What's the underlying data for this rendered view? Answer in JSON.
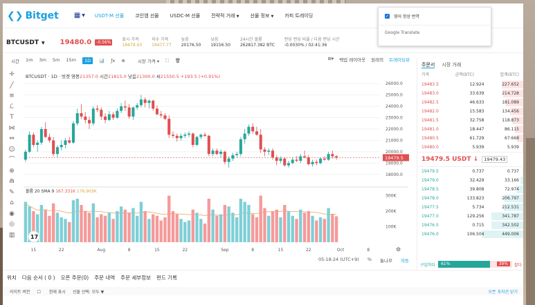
{
  "nav": {
    "logo": "Bitget",
    "items": [
      {
        "label": "USDT-M 선물",
        "active": true,
        "chevron": false
      },
      {
        "label": "코인엠 선물",
        "active": false,
        "chevron": false
      },
      {
        "label": "USDC-M 선물",
        "active": false,
        "chevron": false
      },
      {
        "label": "전략적 거래",
        "active": false,
        "chevron": true
      },
      {
        "label": "선물 정보",
        "active": false,
        "chevron": true
      },
      {
        "label": "카피 트레이딩",
        "active": false,
        "chevron": false
      }
    ]
  },
  "translate_popup": {
    "always_translate": "영어 항상 번역",
    "brand": "Google Translate"
  },
  "ticker": {
    "symbol": "BTCUSDT",
    "price": "19480.0",
    "change": "-0.56%",
    "stats": [
      {
        "k": "표시 가격",
        "v": "19479.43",
        "orange": true
      },
      {
        "k": "지수 가격",
        "v": "19477.77",
        "orange": true
      },
      {
        "k": "높음",
        "v": "20176.50",
        "orange": false
      },
      {
        "k": "낮음",
        "v": "19156.50",
        "orange": false
      },
      {
        "k": "24시간 볼륨",
        "v": "262817.382 BTC",
        "orange": false
      },
      {
        "k": "펀딩 펀딩 비율 / 다음 펀딩 시간",
        "v": "-0.0030% / 02:41:36",
        "orange": false
      }
    ]
  },
  "toolbar": {
    "timeframes": [
      "시간",
      "1m",
      "3m",
      "5m",
      "15m",
      "1D"
    ],
    "active_timeframe": "1D",
    "market_price": "시장 가격",
    "right": [
      "백업 레이아웃",
      "원래의",
      "트레이딩뷰"
    ]
  },
  "chart_info": {
    "title": "BTCUSDT · 1D · 빗겟",
    "open_label": "영봉",
    "open": "21357.0",
    "high_label": "시간",
    "high": "21815.0",
    "low_label": "낮음",
    "low": "21300.0",
    "close_label": "씨",
    "close": "21550.5",
    "change": "+193.5 (+0.91%)"
  },
  "vol_info": {
    "label": "볼륨 20 SMA 9",
    "v1": "167.331K",
    "v2": "176.903K"
  },
  "chart_data": {
    "type": "candlestick",
    "title": "BTCUSDT · 1D · 빗겟",
    "yticks": [
      "26000.0",
      "25000.0",
      "24000.0",
      "23000.0",
      "22000.0",
      "21000.0",
      "20000.0",
      "19000.0",
      "18000.0"
    ],
    "ylim": [
      17500,
      26500
    ],
    "vol_ticks": [
      "300K",
      "200K",
      "100K"
    ],
    "xticks": [
      {
        "label": "15",
        "i": 2
      },
      {
        "label": "22",
        "i": 9
      },
      {
        "label": "Aug",
        "i": 19
      },
      {
        "label": "8",
        "i": 26
      },
      {
        "label": "15",
        "i": 33
      },
      {
        "label": "22",
        "i": 40
      },
      {
        "label": "Sep",
        "i": 50
      },
      {
        "label": "8",
        "i": 57
      },
      {
        "label": "15",
        "i": 64
      },
      {
        "label": "22",
        "i": 71
      },
      {
        "label": "Oct",
        "i": 79
      },
      {
        "label": "8",
        "i": 86
      }
    ],
    "last_price": "19479.5",
    "candles": [
      {
        "o": 19300,
        "h": 20200,
        "l": 19100,
        "c": 20000,
        "v": 260
      },
      {
        "o": 20000,
        "h": 21800,
        "l": 19900,
        "c": 21500,
        "v": 230
      },
      {
        "o": 21500,
        "h": 21700,
        "l": 20400,
        "c": 20600,
        "v": 200
      },
      {
        "o": 20600,
        "h": 21000,
        "l": 20000,
        "c": 20800,
        "v": 180
      },
      {
        "o": 20800,
        "h": 22200,
        "l": 20600,
        "c": 22000,
        "v": 240
      },
      {
        "o": 22000,
        "h": 22600,
        "l": 21200,
        "c": 21300,
        "v": 210
      },
      {
        "o": 21300,
        "h": 21600,
        "l": 20800,
        "c": 21000,
        "v": 170
      },
      {
        "o": 21000,
        "h": 21300,
        "l": 19600,
        "c": 19800,
        "v": 250
      },
      {
        "o": 19800,
        "h": 20600,
        "l": 19500,
        "c": 20400,
        "v": 190
      },
      {
        "o": 20400,
        "h": 21000,
        "l": 20100,
        "c": 20600,
        "v": 160
      },
      {
        "o": 20600,
        "h": 21200,
        "l": 20300,
        "c": 21000,
        "v": 150
      },
      {
        "o": 21000,
        "h": 21300,
        "l": 20700,
        "c": 20800,
        "v": 130
      },
      {
        "o": 20800,
        "h": 22700,
        "l": 20700,
        "c": 22500,
        "v": 270
      },
      {
        "o": 22500,
        "h": 23800,
        "l": 22300,
        "c": 23400,
        "v": 280
      },
      {
        "o": 23400,
        "h": 24200,
        "l": 22900,
        "c": 23100,
        "v": 240
      },
      {
        "o": 23100,
        "h": 23500,
        "l": 22500,
        "c": 22800,
        "v": 200
      },
      {
        "o": 22800,
        "h": 23100,
        "l": 22000,
        "c": 22500,
        "v": 190
      },
      {
        "o": 22500,
        "h": 24000,
        "l": 22300,
        "c": 23800,
        "v": 250
      },
      {
        "o": 23800,
        "h": 24100,
        "l": 23500,
        "c": 23700,
        "v": 160
      },
      {
        "o": 23700,
        "h": 23900,
        "l": 22800,
        "c": 23100,
        "v": 180
      },
      {
        "o": 23100,
        "h": 23400,
        "l": 22500,
        "c": 22800,
        "v": 170
      },
      {
        "o": 22800,
        "h": 23600,
        "l": 22700,
        "c": 23300,
        "v": 190
      },
      {
        "o": 23300,
        "h": 23500,
        "l": 22800,
        "c": 23000,
        "v": 150
      },
      {
        "o": 23000,
        "h": 23800,
        "l": 22900,
        "c": 23600,
        "v": 200
      },
      {
        "o": 23600,
        "h": 24300,
        "l": 23400,
        "c": 24000,
        "v": 230
      },
      {
        "o": 24000,
        "h": 24500,
        "l": 23600,
        "c": 23900,
        "v": 210
      },
      {
        "o": 23900,
        "h": 24200,
        "l": 22900,
        "c": 23100,
        "v": 190
      },
      {
        "o": 23100,
        "h": 24000,
        "l": 22800,
        "c": 23900,
        "v": 220
      },
      {
        "o": 23900,
        "h": 24300,
        "l": 23700,
        "c": 24100,
        "v": 170
      },
      {
        "o": 24100,
        "h": 25000,
        "l": 23900,
        "c": 24600,
        "v": 260
      },
      {
        "o": 24600,
        "h": 24800,
        "l": 23900,
        "c": 24300,
        "v": 200
      },
      {
        "o": 24300,
        "h": 24600,
        "l": 23800,
        "c": 24500,
        "v": 150
      },
      {
        "o": 24500,
        "h": 24600,
        "l": 23600,
        "c": 23800,
        "v": 180
      },
      {
        "o": 23800,
        "h": 24100,
        "l": 23200,
        "c": 23300,
        "v": 170
      },
      {
        "o": 23300,
        "h": 23600,
        "l": 23000,
        "c": 23200,
        "v": 140
      },
      {
        "o": 23200,
        "h": 23400,
        "l": 22800,
        "c": 22900,
        "v": 160
      },
      {
        "o": 22900,
        "h": 23200,
        "l": 21200,
        "c": 21500,
        "v": 300
      },
      {
        "o": 21500,
        "h": 21800,
        "l": 21200,
        "c": 21400,
        "v": 200
      },
      {
        "o": 21400,
        "h": 21600,
        "l": 20900,
        "c": 21200,
        "v": 180
      },
      {
        "o": 21200,
        "h": 21600,
        "l": 21000,
        "c": 21400,
        "v": 150
      },
      {
        "o": 21400,
        "h": 21700,
        "l": 21200,
        "c": 21500,
        "v": 130
      },
      {
        "o": 21500,
        "h": 21800,
        "l": 21300,
        "c": 21600,
        "v": 140
      },
      {
        "o": 21600,
        "h": 21700,
        "l": 20400,
        "c": 20600,
        "v": 210
      },
      {
        "o": 20600,
        "h": 21400,
        "l": 20500,
        "c": 21300,
        "v": 190
      },
      {
        "o": 21300,
        "h": 21600,
        "l": 21100,
        "c": 21500,
        "v": 150
      },
      {
        "o": 21500,
        "h": 21700,
        "l": 21300,
        "c": 21400,
        "v": 120
      },
      {
        "o": 21400,
        "h": 21500,
        "l": 19600,
        "c": 19800,
        "v": 280
      },
      {
        "o": 19800,
        "h": 20300,
        "l": 19600,
        "c": 20100,
        "v": 210
      },
      {
        "o": 20100,
        "h": 20300,
        "l": 19700,
        "c": 19800,
        "v": 170
      },
      {
        "o": 19800,
        "h": 20200,
        "l": 19500,
        "c": 20000,
        "v": 180
      },
      {
        "o": 20000,
        "h": 20100,
        "l": 18900,
        "c": 19100,
        "v": 240
      },
      {
        "o": 19100,
        "h": 19600,
        "l": 18600,
        "c": 19400,
        "v": 230
      },
      {
        "o": 19400,
        "h": 19900,
        "l": 19200,
        "c": 19700,
        "v": 190
      },
      {
        "o": 19700,
        "h": 20000,
        "l": 19500,
        "c": 19800,
        "v": 160
      },
      {
        "o": 19800,
        "h": 21300,
        "l": 19600,
        "c": 21100,
        "v": 280
      },
      {
        "o": 21100,
        "h": 22000,
        "l": 20700,
        "c": 21600,
        "v": 260
      },
      {
        "o": 21600,
        "h": 22400,
        "l": 21400,
        "c": 22200,
        "v": 240
      },
      {
        "o": 22200,
        "h": 22500,
        "l": 21600,
        "c": 21800,
        "v": 180
      },
      {
        "o": 21800,
        "h": 22200,
        "l": 21400,
        "c": 21500,
        "v": 160
      },
      {
        "o": 21500,
        "h": 22000,
        "l": 19900,
        "c": 20200,
        "v": 300
      },
      {
        "o": 20200,
        "h": 20400,
        "l": 19600,
        "c": 20000,
        "v": 220
      },
      {
        "o": 20000,
        "h": 20300,
        "l": 19700,
        "c": 20100,
        "v": 170
      },
      {
        "o": 20100,
        "h": 20300,
        "l": 19300,
        "c": 19500,
        "v": 200
      },
      {
        "o": 19500,
        "h": 19700,
        "l": 18800,
        "c": 19200,
        "v": 210
      },
      {
        "o": 19200,
        "h": 19600,
        "l": 19000,
        "c": 19400,
        "v": 160
      },
      {
        "o": 19400,
        "h": 19500,
        "l": 18700,
        "c": 18800,
        "v": 240
      },
      {
        "o": 18800,
        "h": 19200,
        "l": 18600,
        "c": 19000,
        "v": 200
      },
      {
        "o": 19000,
        "h": 19500,
        "l": 18900,
        "c": 19300,
        "v": 170
      },
      {
        "o": 19300,
        "h": 19600,
        "l": 19100,
        "c": 19200,
        "v": 150
      },
      {
        "o": 19200,
        "h": 19800,
        "l": 19000,
        "c": 19600,
        "v": 210
      },
      {
        "o": 19600,
        "h": 20100,
        "l": 19400,
        "c": 19500,
        "v": 190
      },
      {
        "o": 19500,
        "h": 19700,
        "l": 18800,
        "c": 18900,
        "v": 200
      },
      {
        "o": 18900,
        "h": 19300,
        "l": 18700,
        "c": 19100,
        "v": 170
      },
      {
        "o": 19100,
        "h": 19300,
        "l": 18800,
        "c": 19000,
        "v": 140
      },
      {
        "o": 19000,
        "h": 19500,
        "l": 18900,
        "c": 19400,
        "v": 160
      },
      {
        "o": 19400,
        "h": 19600,
        "l": 19200,
        "c": 19300,
        "v": 150
      },
      {
        "o": 19300,
        "h": 20000,
        "l": 19200,
        "c": 19800,
        "v": 220
      },
      {
        "o": 19800,
        "h": 20100,
        "l": 19400,
        "c": 19600,
        "v": 180
      },
      {
        "o": 19600,
        "h": 19700,
        "l": 19300,
        "c": 19480,
        "v": 167
      }
    ]
  },
  "time_bar": {
    "time": "05:18:24 (UTC+9)",
    "pct": "%",
    "log": "통나무",
    "auto": "자동"
  },
  "orderbook": {
    "tabs": [
      "주문서",
      "시장 거래"
    ],
    "headers": [
      "가격",
      "금액(BTC)",
      "합계(BTC)"
    ],
    "asks": [
      {
        "p": "19483.5",
        "q": "12.924",
        "t": "227.652",
        "d": 0.52
      },
      {
        "p": "19483.0",
        "q": "33.639",
        "t": "214.728",
        "d": 0.49
      },
      {
        "p": "19482.5",
        "q": "46.633",
        "t": "181.089",
        "d": 0.41
      },
      {
        "p": "19482.0",
        "q": "15.583",
        "t": "134.456",
        "d": 0.31
      },
      {
        "p": "19481.5",
        "q": "32.758",
        "t": "118.873",
        "d": 0.27
      },
      {
        "p": "19481.0",
        "q": "18.447",
        "t": "86.115",
        "d": 0.2
      },
      {
        "p": "19480.5",
        "q": "61.729",
        "t": "67.668",
        "d": 0.15
      },
      {
        "p": "19480.0",
        "q": "5.939",
        "t": "5.939",
        "d": 0.01
      }
    ],
    "mid_price": "19479.5 USDT ↓",
    "mark": "19479.43",
    "bids": [
      {
        "p": "19479.5",
        "q": "0.737",
        "t": "0.737",
        "d": 0.01
      },
      {
        "p": "19479.0",
        "q": "32.429",
        "t": "33.166",
        "d": 0.07
      },
      {
        "p": "19478.5",
        "q": "39.808",
        "t": "72.974",
        "d": 0.16
      },
      {
        "p": "19478.0",
        "q": "133.823",
        "t": "206.797",
        "d": 0.46
      },
      {
        "p": "19477.5",
        "q": "5.734",
        "t": "212.531",
        "d": 0.47
      },
      {
        "p": "19477.0",
        "q": "129.256",
        "t": "341.787",
        "d": 0.76
      },
      {
        "p": "19476.5",
        "q": "0.715",
        "t": "342.502",
        "d": 0.76
      },
      {
        "p": "19476.0",
        "q": "106.504",
        "t": "449.006",
        "d": 1.0
      }
    ],
    "buy_label": "구입하다",
    "buy_pct": "61%",
    "sell_pct": "39%",
    "sell_label": "팔다"
  },
  "bottom": {
    "tabs": [
      "위치",
      "다음 순서 ( 0 )",
      "오픈 주문(0)",
      "주문 내역",
      "주문 세부정보",
      "펀드 기록"
    ],
    "sub": [
      "라이트 버전",
      "현재 표시",
      "선물 선택: 모두 ▼"
    ],
    "close_all": "오픈 포지션 닫기"
  },
  "colors": {
    "up": "#26a69a",
    "down": "#e04f50",
    "accent": "#1a9fe0"
  }
}
